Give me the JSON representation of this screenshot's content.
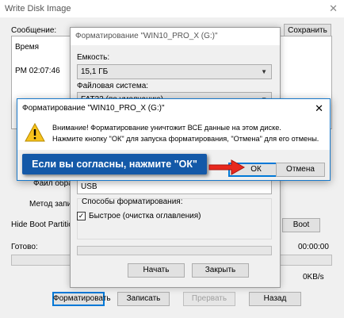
{
  "background_window": {
    "title": "Write Disk Image",
    "close_glyph": "✕",
    "message_label": "Сообщение:",
    "save_button": "Сохранить",
    "log_header": "Время",
    "log_time": "PM 02:07:46",
    "image_file_label": "Файл образа",
    "write_method_label": "Метод записи",
    "hide_boot_label": "Hide Boot Partition",
    "boot_button_partial": "Boot",
    "ready_label": "Готово:",
    "elapsed": "00:00:00",
    "speed": "0KB/s",
    "buttons": {
      "format": "Форматировать",
      "write": "Записать",
      "abort": "Прервать",
      "back": "Назад"
    }
  },
  "format_dialog": {
    "title": "Форматирование \"WIN10_PRO_X (G:)\"",
    "capacity_label": "Емкость:",
    "capacity_value": "15,1 ГБ",
    "filesystem_label": "Файловая система:",
    "filesystem_value": "FAT32 (по умолчанию)",
    "volume_value": "USB",
    "methods_label": "Способы форматирования:",
    "quick_format_label": "Быстрое (очистка оглавления)",
    "quick_format_checked": true,
    "start_button": "Начать",
    "close_button": "Закрыть"
  },
  "warning_dialog": {
    "title": "Форматирование \"WIN10_PRO_X (G:)\"",
    "close_glyph": "✕",
    "icon": "warning-icon",
    "line1": "Внимание! Форматирование уничтожит ВСЕ данные на этом диске.",
    "line2": "Нажмите кнопку \"ОК\" для запуска форматирования, \"Отмена\" для его отмены.",
    "ok_button": "ОК",
    "cancel_button": "Отмена"
  },
  "callout": {
    "text": "Если вы согласны, нажмите \"ОК\"",
    "background_color": "#1459a8",
    "arrow_color": "#e8281e"
  }
}
